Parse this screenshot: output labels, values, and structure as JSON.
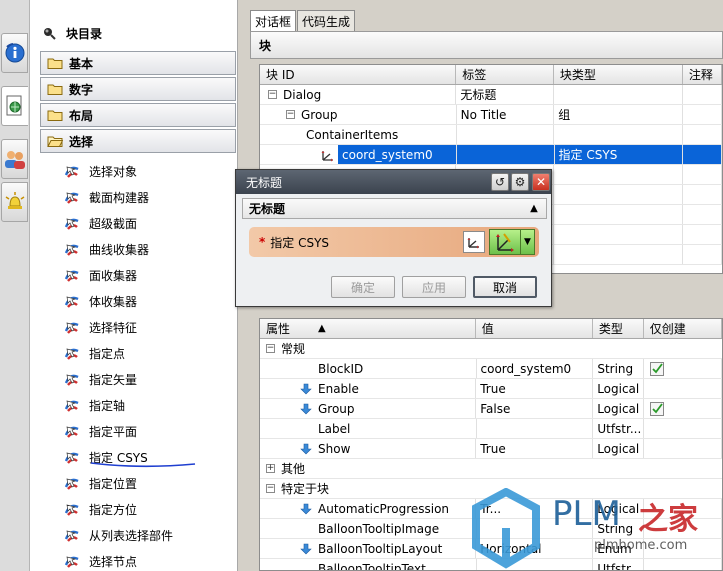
{
  "rail": {
    "buttons": [
      "info-icon",
      "document-globe-icon",
      "users-icon",
      "alert-bell-icon"
    ]
  },
  "tree": {
    "title": "块目录",
    "categories": [
      {
        "label": "基本",
        "open": false
      },
      {
        "label": "数字",
        "open": false
      },
      {
        "label": "布局",
        "open": false
      },
      {
        "label": "选择",
        "open": true
      }
    ],
    "items": [
      "选择对象",
      "截面构建器",
      "超级截面",
      "曲线收集器",
      "面收集器",
      "体收集器",
      "选择特征",
      "指定点",
      "指定矢量",
      "指定轴",
      "指定平面",
      "指定 CSYS",
      "指定位置",
      "指定方位",
      "从列表选择部件",
      "选择节点"
    ]
  },
  "tabs": [
    {
      "label": "对话框",
      "active": true
    },
    {
      "label": "代码生成",
      "active": false
    }
  ],
  "block_section": {
    "title": "块",
    "columns": [
      "块 ID",
      "标签",
      "块类型",
      "注释"
    ],
    "rows": [
      {
        "id": "Dialog",
        "label": "无标题",
        "type": "",
        "level": 0,
        "expander": "−"
      },
      {
        "id": "Group",
        "label": "No Title",
        "type": "组",
        "level": 1,
        "expander": "−"
      },
      {
        "id": "ContainerItems",
        "label": "",
        "type": "",
        "level": 2,
        "expander": ""
      },
      {
        "id": "coord_system0",
        "label": "",
        "type": "指定 CSYS",
        "level": 3,
        "expander": "",
        "selected": true
      }
    ]
  },
  "props": {
    "columns": [
      "属性",
      "值",
      "类型",
      "仅创建"
    ],
    "rows": [
      {
        "kind": "group",
        "name": "常规",
        "expander": "−"
      },
      {
        "kind": "prop",
        "name": "BlockID",
        "value": "coord_system0",
        "type": "String",
        "create_only": true,
        "arrow": false
      },
      {
        "kind": "prop",
        "name": "Enable",
        "value": "True",
        "type": "Logical",
        "create_only": false,
        "arrow": true
      },
      {
        "kind": "prop",
        "name": "Group",
        "value": "False",
        "type": "Logical",
        "create_only": true,
        "arrow": true
      },
      {
        "kind": "prop",
        "name": "Label",
        "value": "",
        "type": "Utfstr...",
        "create_only": false,
        "arrow": false
      },
      {
        "kind": "prop",
        "name": "Show",
        "value": "True",
        "type": "Logical",
        "create_only": false,
        "arrow": true
      },
      {
        "kind": "group",
        "name": "其他",
        "expander": "+"
      },
      {
        "kind": "group",
        "name": "特定于块",
        "expander": "−"
      },
      {
        "kind": "prop",
        "name": "AutomaticProgression",
        "value": "Tr...",
        "type": "Logical",
        "create_only": false,
        "arrow": true
      },
      {
        "kind": "prop",
        "name": "BalloonTooltipImage",
        "value": "",
        "type": "String",
        "create_only": false,
        "arrow": false
      },
      {
        "kind": "prop",
        "name": "BalloonTooltipLayout",
        "value": "Horizontal",
        "type": "Enum",
        "create_only": false,
        "arrow": true
      },
      {
        "kind": "prop",
        "name": "BalloonTooltipText",
        "value": "",
        "type": "Utfstr",
        "create_only": false,
        "arrow": false
      }
    ]
  },
  "dialog": {
    "title": "无标题",
    "section": "无标题",
    "csys_label": "指定 CSYS",
    "required_mark": "*",
    "ok": "确定",
    "apply": "应用",
    "cancel": "取消"
  },
  "watermark": {
    "brand": "PLM",
    "brand_cn": "之家",
    "url": "plmhome.com"
  },
  "colors": {
    "selection": "#0a64d8",
    "csys_required": "#e7a77c",
    "annotation_underline": "#1f3fd0"
  }
}
